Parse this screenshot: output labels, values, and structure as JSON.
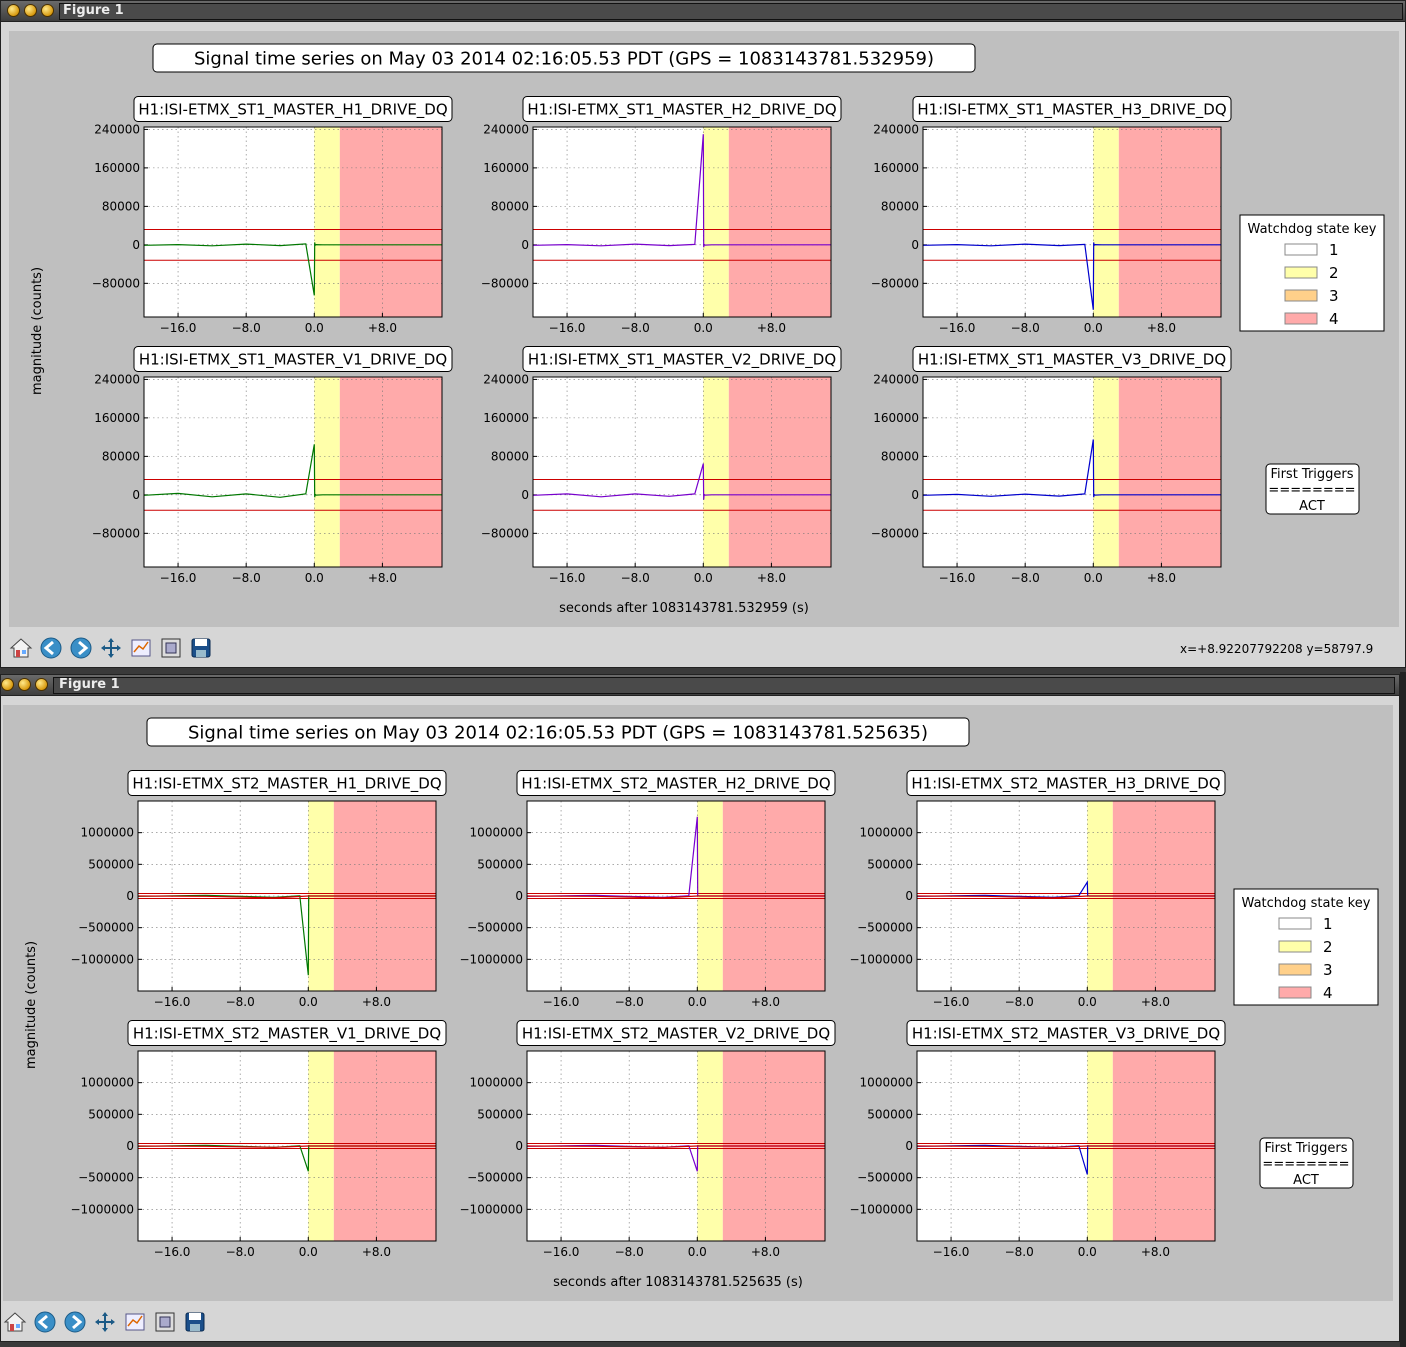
{
  "windows": [
    {
      "title": "Figure 1",
      "figure_title": "Signal time series on May 03 2014 02:16:05.53 PDT (GPS = 1083143781.532959)",
      "xlabel": "seconds after 1083143781.532959 (s)",
      "ylabel": "magnitude (counts)",
      "coords": "x=+8.92207792208 y=58797.9",
      "legend_title": "Watchdog state key",
      "legend_items": [
        "1",
        "2",
        "3",
        "4"
      ],
      "triggers": [
        "First Triggers",
        "========",
        "ACT"
      ]
    },
    {
      "title": "Figure 1",
      "figure_title": "Signal time series on May 03 2014 02:16:05.53 PDT (GPS = 1083143781.525635)",
      "xlabel": "seconds after 1083143781.525635 (s)",
      "ylabel": "magnitude (counts)",
      "coords": "",
      "legend_title": "Watchdog state key",
      "legend_items": [
        "1",
        "2",
        "3",
        "4"
      ],
      "triggers": [
        "First Triggers",
        "========",
        "ACT"
      ]
    }
  ],
  "colors": {
    "state_1": "#ffffff",
    "state_2": "#ffffaa",
    "state_3": "#ffd08a",
    "state_4": "#ffaaaa",
    "threshold": "#cc0000",
    "green_trace": "#007700",
    "purple_trace": "#7700cc",
    "blue_trace": "#0000cc"
  },
  "toolbar": [
    "home-icon",
    "back-icon",
    "forward-icon",
    "pan-icon",
    "subplots-icon",
    "zoom-icon",
    "save-icon"
  ],
  "chart_data": [
    {
      "type": "line",
      "title": "H1:ISI-ETMX_ST1_MASTER_H1_DRIVE_DQ",
      "x_ticks": [
        "−16.0",
        "−8.0",
        "0.0",
        "+8.0"
      ],
      "y_ticks": [
        "240000",
        "160000",
        "80000",
        "0",
        "−80000"
      ],
      "xlim": [
        -20,
        15
      ],
      "ylim": [
        -150000,
        245000
      ],
      "state_regions": [
        {
          "state": 2,
          "x": [
            0,
            3
          ]
        },
        {
          "state": 4,
          "x": [
            3,
            15
          ]
        }
      ],
      "thresholds": [
        32000,
        -32000
      ],
      "series": [
        {
          "color": "green",
          "x": [
            -20,
            -16,
            -12,
            -8,
            -4,
            -1,
            0,
            0.05,
            0.1,
            0.2,
            1,
            15
          ],
          "y": [
            -1000,
            500,
            -2000,
            1500,
            -1500,
            2000,
            -105000,
            5000,
            -1000,
            500,
            0,
            0
          ]
        }
      ]
    },
    {
      "type": "line",
      "title": "H1:ISI-ETMX_ST1_MASTER_H2_DRIVE_DQ",
      "x_ticks": [
        "−16.0",
        "−8.0",
        "0.0",
        "+8.0"
      ],
      "y_ticks": [
        "240000",
        "160000",
        "80000",
        "0",
        "−80000"
      ],
      "xlim": [
        -20,
        15
      ],
      "ylim": [
        -150000,
        245000
      ],
      "state_regions": [
        {
          "state": 2,
          "x": [
            0,
            3
          ]
        },
        {
          "state": 4,
          "x": [
            3,
            15
          ]
        }
      ],
      "thresholds": [
        32000,
        -32000
      ],
      "series": [
        {
          "color": "purple",
          "x": [
            -20,
            -16,
            -12,
            -8,
            -4,
            -1,
            0,
            0.05,
            0.1,
            0.2,
            1,
            15
          ],
          "y": [
            -1000,
            500,
            -2000,
            1500,
            -1500,
            1000,
            230000,
            -5000,
            1000,
            -500,
            0,
            0
          ]
        }
      ]
    },
    {
      "type": "line",
      "title": "H1:ISI-ETMX_ST1_MASTER_H3_DRIVE_DQ",
      "x_ticks": [
        "−16.0",
        "−8.0",
        "0.0",
        "+8.0"
      ],
      "y_ticks": [
        "240000",
        "160000",
        "80000",
        "0",
        "−80000"
      ],
      "xlim": [
        -20,
        15
      ],
      "ylim": [
        -150000,
        245000
      ],
      "state_regions": [
        {
          "state": 2,
          "x": [
            0,
            3
          ]
        },
        {
          "state": 4,
          "x": [
            3,
            15
          ]
        }
      ],
      "thresholds": [
        32000,
        -32000
      ],
      "series": [
        {
          "color": "blue",
          "x": [
            -20,
            -16,
            -12,
            -8,
            -4,
            -1,
            0,
            0.05,
            0.1,
            0.2,
            1,
            15
          ],
          "y": [
            -1000,
            500,
            -2000,
            1500,
            -1500,
            1000,
            -135000,
            5000,
            -1000,
            500,
            0,
            0
          ]
        }
      ]
    },
    {
      "type": "line",
      "title": "H1:ISI-ETMX_ST1_MASTER_V1_DRIVE_DQ",
      "x_ticks": [
        "−16.0",
        "−8.0",
        "0.0",
        "+8.0"
      ],
      "y_ticks": [
        "240000",
        "160000",
        "80000",
        "0",
        "−80000"
      ],
      "xlim": [
        -20,
        15
      ],
      "ylim": [
        -150000,
        245000
      ],
      "state_regions": [
        {
          "state": 2,
          "x": [
            0,
            3
          ]
        },
        {
          "state": 4,
          "x": [
            3,
            15
          ]
        }
      ],
      "thresholds": [
        32000,
        -32000
      ],
      "series": [
        {
          "color": "green",
          "x": [
            -20,
            -16,
            -12,
            -8,
            -4,
            -1,
            0,
            0.05,
            0.1,
            0.2,
            1,
            15
          ],
          "y": [
            -1000,
            3000,
            -4000,
            2000,
            -5000,
            2000,
            105000,
            -5000,
            1000,
            -500,
            0,
            0
          ]
        }
      ]
    },
    {
      "type": "line",
      "title": "H1:ISI-ETMX_ST1_MASTER_V2_DRIVE_DQ",
      "x_ticks": [
        "−16.0",
        "−8.0",
        "0.0",
        "+8.0"
      ],
      "y_ticks": [
        "240000",
        "160000",
        "80000",
        "0",
        "−80000"
      ],
      "xlim": [
        -20,
        15
      ],
      "ylim": [
        -150000,
        245000
      ],
      "state_regions": [
        {
          "state": 2,
          "x": [
            0,
            3
          ]
        },
        {
          "state": 4,
          "x": [
            3,
            15
          ]
        }
      ],
      "thresholds": [
        32000,
        -32000
      ],
      "series": [
        {
          "color": "purple",
          "x": [
            -20,
            -16,
            -12,
            -8,
            -4,
            -1,
            0,
            0.05,
            0.1,
            0.2,
            1,
            15
          ],
          "y": [
            -1000,
            2000,
            -4000,
            2000,
            -3000,
            2000,
            65000,
            -10000,
            1000,
            -500,
            0,
            0
          ]
        }
      ]
    },
    {
      "type": "line",
      "title": "H1:ISI-ETMX_ST1_MASTER_V3_DRIVE_DQ",
      "x_ticks": [
        "−16.0",
        "−8.0",
        "0.0",
        "+8.0"
      ],
      "y_ticks": [
        "240000",
        "160000",
        "80000",
        "0",
        "−80000"
      ],
      "xlim": [
        -20,
        15
      ],
      "ylim": [
        -150000,
        245000
      ],
      "state_regions": [
        {
          "state": 2,
          "x": [
            0,
            3
          ]
        },
        {
          "state": 4,
          "x": [
            3,
            15
          ]
        }
      ],
      "thresholds": [
        32000,
        -32000
      ],
      "series": [
        {
          "color": "blue",
          "x": [
            -20,
            -16,
            -12,
            -8,
            -4,
            -1,
            0,
            0.05,
            0.1,
            0.2,
            1,
            15
          ],
          "y": [
            -1000,
            1000,
            -3000,
            1500,
            -2500,
            2000,
            115000,
            -5000,
            1000,
            -500,
            0,
            0
          ]
        }
      ]
    },
    {
      "type": "line",
      "title": "H1:ISI-ETMX_ST2_MASTER_H1_DRIVE_DQ",
      "x_ticks": [
        "−16.0",
        "−8.0",
        "0.0",
        "+8.0"
      ],
      "y_ticks": [
        "1000000",
        "500000",
        "0",
        "−500000",
        "−1000000"
      ],
      "xlim": [
        -20,
        15
      ],
      "ylim": [
        -1500000,
        1500000
      ],
      "state_regions": [
        {
          "state": 2,
          "x": [
            0,
            3
          ]
        },
        {
          "state": 4,
          "x": [
            3,
            15
          ]
        }
      ],
      "thresholds": [
        40000,
        -40000
      ],
      "series": [
        {
          "color": "green",
          "x": [
            -20,
            -12,
            -4,
            -1,
            0,
            0.05,
            0.2,
            15
          ],
          "y": [
            -5000,
            10000,
            -20000,
            5000,
            -1250000,
            5000,
            0,
            0
          ]
        },
        {
          "color": "red",
          "x": [
            -20,
            -12,
            -4,
            0,
            15
          ],
          "y": [
            0,
            -5000,
            -30000,
            0,
            0
          ]
        }
      ]
    },
    {
      "type": "line",
      "title": "H1:ISI-ETMX_ST2_MASTER_H2_DRIVE_DQ",
      "x_ticks": [
        "−16.0",
        "−8.0",
        "0.0",
        "+8.0"
      ],
      "y_ticks": [
        "1000000",
        "500000",
        "0",
        "−500000",
        "−1000000"
      ],
      "xlim": [
        -20,
        15
      ],
      "ylim": [
        -1500000,
        1500000
      ],
      "state_regions": [
        {
          "state": 2,
          "x": [
            0,
            3
          ]
        },
        {
          "state": 4,
          "x": [
            3,
            15
          ]
        }
      ],
      "thresholds": [
        40000,
        -40000
      ],
      "series": [
        {
          "color": "purple",
          "x": [
            -20,
            -12,
            -4,
            -1,
            0,
            0.05,
            0.2,
            15
          ],
          "y": [
            -5000,
            10000,
            -20000,
            5000,
            1250000,
            5000,
            0,
            0
          ]
        },
        {
          "color": "red",
          "x": [
            -20,
            -12,
            -4,
            0,
            15
          ],
          "y": [
            0,
            -5000,
            -30000,
            0,
            0
          ]
        }
      ]
    },
    {
      "type": "line",
      "title": "H1:ISI-ETMX_ST2_MASTER_H3_DRIVE_DQ",
      "x_ticks": [
        "−16.0",
        "−8.0",
        "0.0",
        "+8.0"
      ],
      "y_ticks": [
        "1000000",
        "500000",
        "0",
        "−500000",
        "−1000000"
      ],
      "xlim": [
        -20,
        15
      ],
      "ylim": [
        -1500000,
        1500000
      ],
      "state_regions": [
        {
          "state": 2,
          "x": [
            0,
            3
          ]
        },
        {
          "state": 4,
          "x": [
            3,
            15
          ]
        }
      ],
      "thresholds": [
        40000,
        -40000
      ],
      "series": [
        {
          "color": "blue",
          "x": [
            -20,
            -12,
            -4,
            -1,
            0,
            0.05,
            0.2,
            15
          ],
          "y": [
            -5000,
            10000,
            -20000,
            5000,
            220000,
            5000,
            0,
            0
          ]
        },
        {
          "color": "red",
          "x": [
            -20,
            -12,
            -4,
            0,
            15
          ],
          "y": [
            0,
            -5000,
            -30000,
            0,
            0
          ]
        }
      ]
    },
    {
      "type": "line",
      "title": "H1:ISI-ETMX_ST2_MASTER_V1_DRIVE_DQ",
      "x_ticks": [
        "−16.0",
        "−8.0",
        "0.0",
        "+8.0"
      ],
      "y_ticks": [
        "1000000",
        "500000",
        "0",
        "−500000",
        "−1000000"
      ],
      "xlim": [
        -20,
        15
      ],
      "ylim": [
        -1500000,
        1500000
      ],
      "state_regions": [
        {
          "state": 2,
          "x": [
            0,
            3
          ]
        },
        {
          "state": 4,
          "x": [
            3,
            15
          ]
        }
      ],
      "thresholds": [
        40000,
        -40000
      ],
      "series": [
        {
          "color": "green",
          "x": [
            -20,
            -12,
            -4,
            -1,
            0,
            0.05,
            0.2,
            15
          ],
          "y": [
            -5000,
            10000,
            -20000,
            5000,
            -400000,
            5000,
            0,
            0
          ]
        },
        {
          "color": "red",
          "x": [
            -20,
            -12,
            -4,
            0,
            15
          ],
          "y": [
            0,
            -5000,
            -20000,
            0,
            0
          ]
        }
      ]
    },
    {
      "type": "line",
      "title": "H1:ISI-ETMX_ST2_MASTER_V2_DRIVE_DQ",
      "x_ticks": [
        "−16.0",
        "−8.0",
        "0.0",
        "+8.0"
      ],
      "y_ticks": [
        "1000000",
        "500000",
        "0",
        "−500000",
        "−1000000"
      ],
      "xlim": [
        -20,
        15
      ],
      "ylim": [
        -1500000,
        1500000
      ],
      "state_regions": [
        {
          "state": 2,
          "x": [
            0,
            3
          ]
        },
        {
          "state": 4,
          "x": [
            3,
            15
          ]
        }
      ],
      "thresholds": [
        40000,
        -40000
      ],
      "series": [
        {
          "color": "purple",
          "x": [
            -20,
            -12,
            -4,
            -1,
            0,
            0.05,
            0.2,
            15
          ],
          "y": [
            -5000,
            10000,
            -20000,
            5000,
            -400000,
            5000,
            0,
            0
          ]
        },
        {
          "color": "red",
          "x": [
            -20,
            -12,
            -4,
            0,
            15
          ],
          "y": [
            0,
            -5000,
            -20000,
            0,
            0
          ]
        }
      ]
    },
    {
      "type": "line",
      "title": "H1:ISI-ETMX_ST2_MASTER_V3_DRIVE_DQ",
      "x_ticks": [
        "−16.0",
        "−8.0",
        "0.0",
        "+8.0"
      ],
      "y_ticks": [
        "1000000",
        "500000",
        "0",
        "−500000",
        "−1000000"
      ],
      "xlim": [
        -20,
        15
      ],
      "ylim": [
        -1500000,
        1500000
      ],
      "state_regions": [
        {
          "state": 2,
          "x": [
            0,
            3
          ]
        },
        {
          "state": 4,
          "x": [
            3,
            15
          ]
        }
      ],
      "thresholds": [
        40000,
        -40000
      ],
      "series": [
        {
          "color": "blue",
          "x": [
            -20,
            -12,
            -4,
            -1,
            0,
            0.05,
            0.2,
            15
          ],
          "y": [
            -5000,
            10000,
            -20000,
            5000,
            -450000,
            5000,
            0,
            0
          ]
        },
        {
          "color": "red",
          "x": [
            -20,
            -12,
            -4,
            0,
            15
          ],
          "y": [
            0,
            -5000,
            -20000,
            0,
            0
          ]
        }
      ]
    }
  ]
}
